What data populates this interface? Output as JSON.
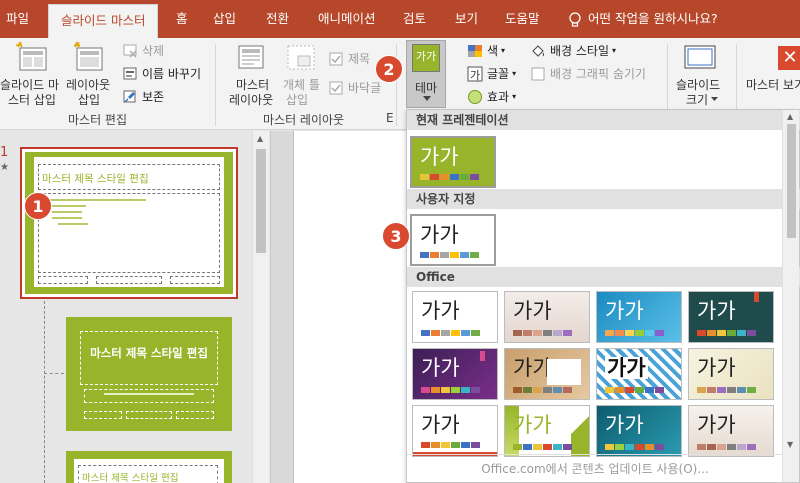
{
  "tabs": [
    "파일",
    "슬라이드 마스터",
    "홈",
    "삽입",
    "전환",
    "애니메이션",
    "검토",
    "보기",
    "도움말"
  ],
  "tellme": "어떤 작업을 원하시나요?",
  "ribbon": {
    "insert_master": [
      "슬라이드 마",
      "스터 삽입"
    ],
    "insert_layout": [
      "레이아웃",
      "삽입"
    ],
    "delete": "삭제",
    "rename": "이름 바꾸기",
    "preserve": "보존",
    "group_master_edit": "마스터 편집",
    "master_layout": [
      "마스터",
      "레이아웃"
    ],
    "insert_placeholder": [
      "개체 틀",
      "삽입"
    ],
    "title_chk": "제목",
    "footer_chk": "바닥글",
    "group_master_layout": "마스터 레이아웃",
    "theme_button_glyph": "가가",
    "theme_button_label": "테마",
    "colors": "색",
    "fonts": "글꼴",
    "effects": "효과",
    "bg_styles": "배경 스타일",
    "hide_bg": "배경 그래픽 숨기기",
    "slide_size": [
      "슬라이드",
      "크기"
    ],
    "close_master": "마스터 보기",
    "group_edit_theme_letter": "E"
  },
  "thumbnails": {
    "slide_number": "1",
    "star": "★",
    "master_title": "마스터 제목 스타일 편집",
    "layout_title": "마스터 제목 스타일 편집",
    "third_title": "마스터 제목 스타일 편집"
  },
  "dropdown": {
    "current_header": "현재 프레젠테이션",
    "custom_header": "사용자 지정",
    "office_header": "Office",
    "glyph": "가가",
    "footer": "Office.com에서 콘텐츠 업데이트 사용(O)..."
  },
  "badges": [
    "1",
    "2",
    "3"
  ],
  "colors": {
    "accent": "#b7472a",
    "theme_green": "#98b42a",
    "badge": "#d9492f"
  }
}
